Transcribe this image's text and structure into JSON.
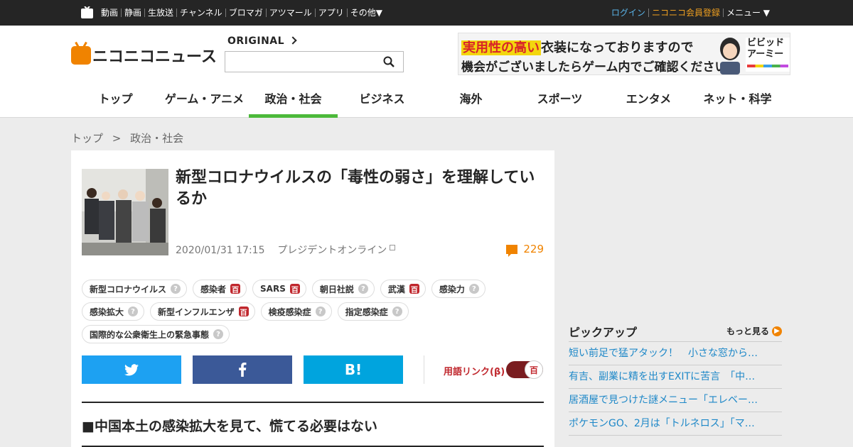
{
  "global_nav": {
    "items": [
      "動画",
      "静画",
      "生放送",
      "チャンネル",
      "ブロマガ",
      "アツマール",
      "アプリ",
      "その他▼"
    ],
    "login": "ログイン",
    "register": "ニコニコ会員登録",
    "menu": "メニュー ▼"
  },
  "header": {
    "logo_text": "ニコニコニュース",
    "original_label": "ORIGINAL",
    "search_placeholder": ""
  },
  "banner": {
    "highlight": "実用性の高い",
    "line1_rest": "衣装になっておりますので",
    "line2": "機会がございましたらゲーム内でご確認ください。",
    "brand": "ビビッドアーミー"
  },
  "categories": [
    {
      "label": "トップ",
      "active": false
    },
    {
      "label": "ゲーム・アニメ",
      "active": false
    },
    {
      "label": "政治・社会",
      "active": true
    },
    {
      "label": "ビジネス",
      "active": false
    },
    {
      "label": "海外",
      "active": false
    },
    {
      "label": "スポーツ",
      "active": false
    },
    {
      "label": "エンタメ",
      "active": false
    },
    {
      "label": "ネット・科学",
      "active": false
    }
  ],
  "breadcrumb": [
    "トップ",
    ">",
    "政治・社会"
  ],
  "article": {
    "title": "新型コロナウイルスの「毒性の弱さ」を理解しているか",
    "datetime": "2020/01/31 17:15",
    "source": "プレジデントオンライン",
    "comment_count": "229",
    "tags": [
      {
        "label": "新型コロナウイルス",
        "icon": "q"
      },
      {
        "label": "感染者",
        "icon": "d"
      },
      {
        "label": "SARS",
        "icon": "d"
      },
      {
        "label": "朝日社説",
        "icon": "q"
      },
      {
        "label": "武漢",
        "icon": "d"
      },
      {
        "label": "感染力",
        "icon": "q"
      },
      {
        "label": "感染拡大",
        "icon": "q"
      },
      {
        "label": "新型インフルエンザ",
        "icon": "d"
      },
      {
        "label": "検疫感染症",
        "icon": "q"
      },
      {
        "label": "指定感染症",
        "icon": "q"
      },
      {
        "label": "国際的な公衆衛生上の緊急事態",
        "icon": "q"
      }
    ],
    "share": {
      "hatena": "B!"
    },
    "term_link_label": "用語リンク(β)",
    "term_toggle_glyph": "百",
    "subheading": "■中国本土の感染拡大を見て、慌てる必要はない"
  },
  "pickup": {
    "title": "ピックアップ",
    "more": "もっと見る",
    "items": [
      "短い前足で猛アタック！　小さな窓から…",
      "有吉、副業に精を出すEXITに苦言　「中…",
      "居酒屋で見つけた謎メニュー「エレベー…",
      "ポケモンGO、2月は「トルネロス」「マ…"
    ]
  },
  "colors": {
    "accent": "#f08300",
    "active_green": "#4cb93a",
    "link_blue": "#1e88c8",
    "dic_red": "#c0272d"
  }
}
